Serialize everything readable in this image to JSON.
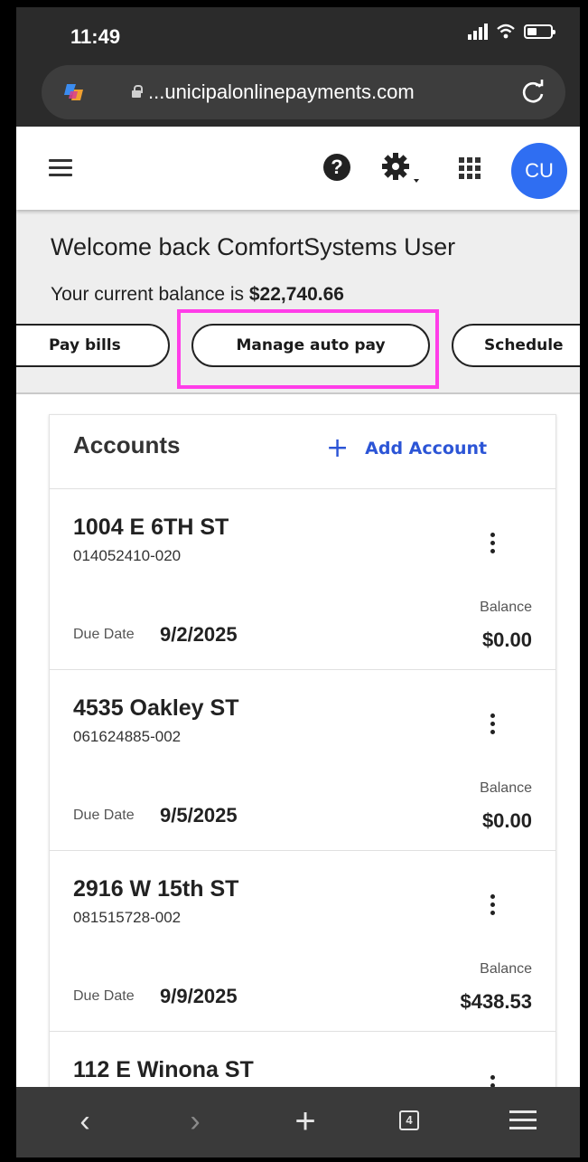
{
  "status_bar": {
    "time": "11:49"
  },
  "browser": {
    "url": "...unicipalonlinepayments.com",
    "icons": [
      "copilot-icon",
      "lock-icon",
      "reload-icon",
      "back-icon",
      "forward-icon",
      "new-tab-icon",
      "tabs-icon",
      "menu-icon"
    ],
    "tab_count": "4"
  },
  "header": {
    "help_label": "?",
    "avatar_initials": "CU"
  },
  "banner": {
    "welcome": "Welcome back ComfortSystems User",
    "balance_prefix": "Your current balance is ",
    "balance_value": "$22,740.66",
    "actions": {
      "pay_bills": "Pay bills",
      "manage_auto_pay": "Manage auto pay",
      "schedule": "Schedule"
    },
    "highlight_color": "#ff3de8"
  },
  "accounts": {
    "title": "Accounts",
    "add_label": "Add Account",
    "plus_symbol": "+",
    "due_label": "Due Date",
    "balance_label": "Balance",
    "items": [
      {
        "address": "1004 E 6TH ST",
        "account": "014052410-020",
        "due": "9/2/2025",
        "balance": "$0.00"
      },
      {
        "address": "4535 Oakley ST",
        "account": "061624885-002",
        "due": "9/5/2025",
        "balance": "$0.00"
      },
      {
        "address": "2916 W 15th ST",
        "account": "081515728-002",
        "due": "9/9/2025",
        "balance": "$438.53"
      },
      {
        "address": "112 E Winona ST"
      }
    ]
  },
  "colors": {
    "accent": "#2c55d6",
    "avatar": "#2f6ef2",
    "banner_bg": "#eeeeee"
  }
}
